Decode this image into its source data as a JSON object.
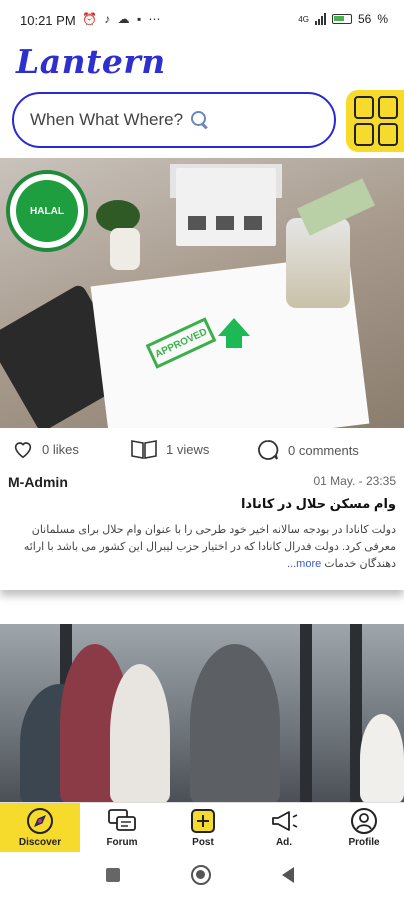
{
  "status_bar": {
    "time": "10:21 PM",
    "notification_icons": [
      "alarm-icon",
      "tiktok-icon",
      "cloud-icon",
      "storage-icon",
      "more-icon"
    ],
    "network": "4G",
    "battery": "56"
  },
  "header": {
    "logo": "Lantern",
    "search_placeholder": "When What Where?",
    "grid_button_icon": "grid-icon"
  },
  "feed": {
    "posts": [
      {
        "image_icons": [
          "halal-badge",
          "house-model",
          "money-jar",
          "approved-document",
          "calculator"
        ],
        "badge_text": "HALAL",
        "stamp_text": "APPROVED",
        "likes": "0 likes",
        "views": "1 views",
        "comments": "0 comments",
        "author": "M-Admin",
        "date": "01 May. - 23:35",
        "title": "وام مسکن حلال در کانادا",
        "body": "دولت کانادا در بودجه سالانه اخیر خود طرحی را با عنوان وام حلال برای مسلمانان معرفی کرد. دولت فدرال کانادا که در اختیار حزب لیبرال این کشور می باشد با ارائه دهندگان خدمات",
        "more": "more..."
      },
      {
        "image_icons": [
          "office-team-photo"
        ]
      }
    ]
  },
  "bottom_nav": {
    "items": [
      {
        "label": "Discover",
        "icon": "discover-icon",
        "active": true
      },
      {
        "label": "Forum",
        "icon": "forum-icon",
        "active": false
      },
      {
        "label": "Post",
        "icon": "post-icon",
        "active": false
      },
      {
        "label": "Ad.",
        "icon": "megaphone-icon",
        "active": false
      },
      {
        "label": "Profile",
        "icon": "profile-icon",
        "active": false
      }
    ]
  },
  "colors": {
    "accent_yellow": "#f7db2c",
    "brand_blue": "#2d2fd0",
    "link_blue": "#3a58c8"
  }
}
